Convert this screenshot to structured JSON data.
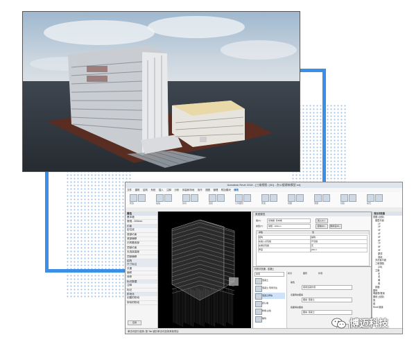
{
  "revit": {
    "title": "Autodesk Revit 2018 - [三维视图: {3D} - 办公楼建筑模型.rvt]",
    "tabs": [
      "文件",
      "建筑",
      "结构",
      "系统",
      "插入",
      "注释",
      "分析",
      "体量和场地",
      "协作",
      "视图",
      "管理",
      "附加模块",
      "修改"
    ],
    "active_tab": "修改",
    "ribbon_labels": [
      "修改",
      "粘贴",
      "剪切",
      "连接",
      "几何图形",
      "修改",
      "视图",
      "测量",
      "创建",
      "模式"
    ],
    "properties": {
      "header": "属性",
      "type_label": "基本墙",
      "type_sub": "常规 - 200mm",
      "rows": [
        "约束",
        "定位线",
        "底部约束",
        "底部偏移",
        "已附着底部",
        "顶部约束",
        "无连接高度",
        "顶部偏移",
        "结构",
        "尺寸标注",
        "长度",
        "面积",
        "体积",
        "标识数据",
        "注释",
        "标记",
        "阶段化",
        "创建的阶段",
        "拆除的阶段"
      ],
      "apply": "应用"
    },
    "dialog": {
      "title": "类型属性",
      "family_label": "族(F):",
      "family_value": "系统族: 基本墙",
      "type_label": "类型(T):",
      "type_value": "常规 - 200mm",
      "load": "载入(L)...",
      "duplicate": "复制(D)...",
      "rename": "重命名(R)...",
      "param_header": "参数",
      "value_header": "值",
      "rows": [
        [
          "结构",
          "编辑..."
        ],
        [
          "在插入点包络",
          "不包络"
        ],
        [
          "在端点包络",
          "无"
        ],
        [
          "厚度",
          "200.0"
        ]
      ],
      "sub_title": "材质浏览器 - 混凝土",
      "search": "搜索",
      "sub_items": [
        "混凝土",
        "混凝土-现场浇注",
        "混凝土砌块",
        "默认墙",
        "粉刷-白色",
        "玻璃"
      ],
      "selected_index": 2,
      "sub_labels": [
        "标识",
        "图形",
        "外观",
        "着色",
        "表面填充图案",
        "截面填充图案"
      ],
      "sub_values": [
        "使用渲染外观",
        "图案: 混凝土",
        "图案: 混凝土"
      ],
      "ok": "确定",
      "cancel": "取消"
    },
    "browser": {
      "header": "项目浏览器",
      "rows": [
        "视图 (全部)",
        "楼层平面",
        "1F",
        "2F",
        "3F",
        "4F",
        "5F",
        "6F",
        "7F",
        "8F",
        "9F",
        "屋顶",
        "场地",
        "天花板平面",
        "三维视图",
        "{3D}",
        "立面",
        "东",
        "北",
        "南",
        "西",
        "剖面",
        "图例",
        "明细表/数量",
        "图纸 (全部)",
        "族",
        "组",
        "Revit 链接"
      ]
    },
    "status": "单击可进行选择; 按 Tab 键并单击可选择其他项目"
  },
  "watermark": "博迈科技",
  "colors": {
    "accent_line": "#3a8fe6",
    "revit_tab_active": "#1c5fb5"
  }
}
